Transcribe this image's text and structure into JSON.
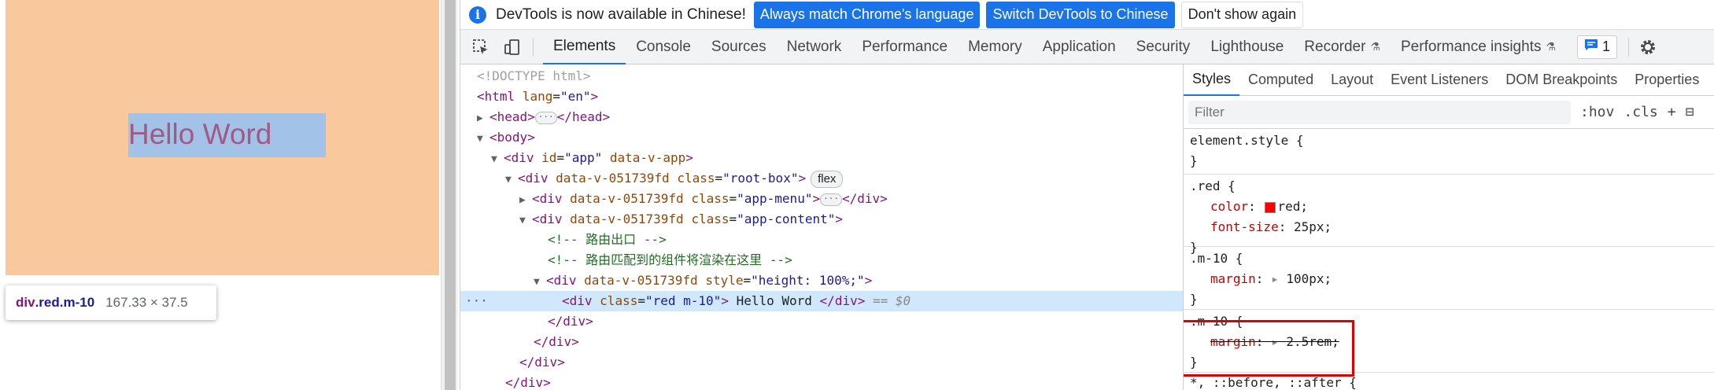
{
  "page": {
    "hello_text": "Hello Word",
    "tooltip": {
      "tag": "div",
      "classes": ".red.m-10",
      "size": "167.33 × 37.5"
    }
  },
  "devtools": {
    "infobar": {
      "message": "DevTools is now available in Chinese!",
      "btn_match": "Always match Chrome's language",
      "btn_switch": "Switch DevTools to Chinese",
      "btn_dismiss": "Don't show again"
    },
    "tabs": [
      "Elements",
      "Console",
      "Sources",
      "Network",
      "Performance",
      "Memory",
      "Application",
      "Security",
      "Lighthouse",
      "Recorder",
      "Performance insights"
    ],
    "issues_count": "1",
    "styles_tabs": [
      "Styles",
      "Computed",
      "Layout",
      "Event Listeners",
      "DOM Breakpoints",
      "Properties"
    ],
    "filter_placeholder": "Filter",
    "filter_buttons": {
      "hov": ":hov",
      "cls": ".cls",
      "add": "+"
    },
    "dom": {
      "doctype": "<!DOCTYPE html>",
      "html_open": "<html",
      "lang_attr": "lang",
      "lang_val": "\"en\"",
      "head_open": "<head>",
      "head_close": "</head>",
      "body_open": "<body>",
      "div_app": "<div",
      "app_id": "id",
      "app_id_val": "\"app\"",
      "app_attr2": "data-v-app",
      "root_box_attr": "data-v-051739fd",
      "root_box_class": "class",
      "root_box_val": "\"root-box\"",
      "flex_badge": "flex",
      "app_menu_val": "\"app-menu\"",
      "div_close": "</div>",
      "app_content_val": "\"app-content\"",
      "comment1": "<!-- 路由出口 -->",
      "comment2": "<!-- 路由匹配到的组件将渲染在这里 -->",
      "style_attr": "style",
      "style_val": "\"height: 100%;\"",
      "sel_class_val": "\"red m-10\"",
      "sel_text": " Hello Word ",
      "sel_eq": "== $0",
      "selected_dots": "···"
    },
    "styles": {
      "element_style": "element.style {",
      "close": "}",
      "red_sel": ".red {",
      "color_name": "color",
      "color_val": "red;",
      "font_size_name": "font-size",
      "font_size_val": "25px;",
      "m10_sel": ".m-10 {",
      "margin_name": "margin",
      "margin_val1": "100px;",
      "margin_val2": "2.5rem;",
      "universal_sel": "*, ::before, ::after {"
    }
  }
}
